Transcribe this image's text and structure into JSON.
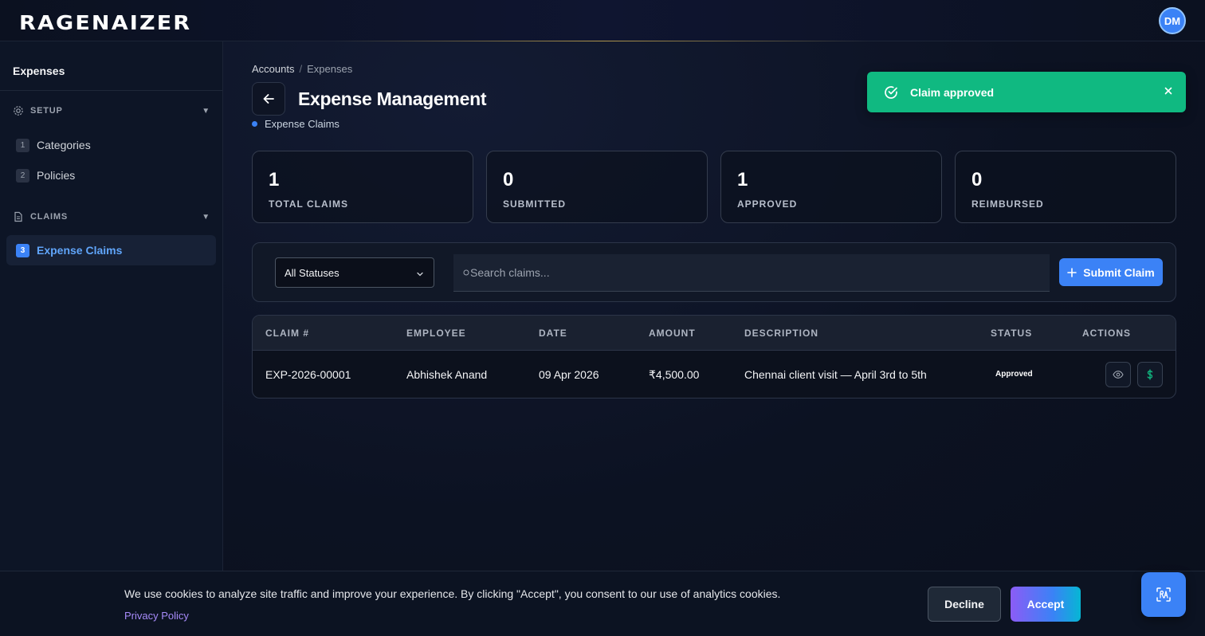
{
  "app": {
    "logo": "RAGENAIZER",
    "user_initials": "DM"
  },
  "sidebar": {
    "title": "Expenses",
    "sections": [
      {
        "label": "SETUP",
        "icon": "gear-icon"
      },
      {
        "label": "CLAIMS",
        "icon": "document-icon"
      }
    ],
    "items": [
      {
        "num": "1",
        "label": "Categories"
      },
      {
        "num": "2",
        "label": "Policies"
      },
      {
        "num": "3",
        "label": "Expense Claims"
      }
    ]
  },
  "breadcrumb": {
    "parent": "Accounts",
    "separator": "/",
    "current": "Expenses"
  },
  "page": {
    "title": "Expense Management",
    "subtitle": "Expense Claims"
  },
  "stats": [
    {
      "value": "1",
      "label": "TOTAL CLAIMS"
    },
    {
      "value": "0",
      "label": "SUBMITTED"
    },
    {
      "value": "1",
      "label": "APPROVED"
    },
    {
      "value": "0",
      "label": "REIMBURSED"
    }
  ],
  "filters": {
    "status_selected": "All Statuses",
    "search_placeholder": "Search claims...",
    "submit_label": "Submit Claim"
  },
  "table": {
    "columns": [
      "CLAIM #",
      "EMPLOYEE",
      "DATE",
      "AMOUNT",
      "DESCRIPTION",
      "STATUS",
      "ACTIONS"
    ],
    "rows": [
      {
        "claim": "EXP-2026-00001",
        "employee": "Abhishek Anand",
        "date": "09 Apr 2026",
        "amount": "₹4,500.00",
        "description": "Chennai client visit — April 3rd to 5th",
        "status": "Approved"
      }
    ]
  },
  "toast": {
    "message": "Claim approved"
  },
  "cookie": {
    "text": "We use cookies to analyze site traffic and improve your experience. By clicking \"Accept\", you consent to our use of analytics cookies.",
    "privacy_label": "Privacy Policy",
    "decline_label": "Decline",
    "accept_label": "Accept"
  },
  "colors": {
    "accent": "#3b82f6",
    "toast_success": "#10b981",
    "background": "#0b1120"
  }
}
